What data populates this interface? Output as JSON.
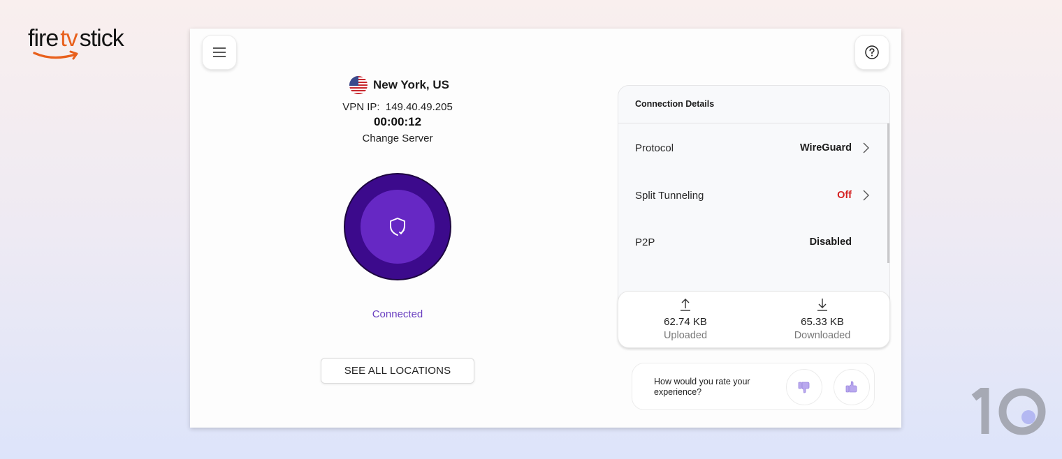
{
  "brand": {
    "logo_parts": [
      "fire",
      "tv",
      "stick"
    ],
    "logo_accent_color": "#e8601c",
    "watermark": "10"
  },
  "header": {
    "menu_icon": "hamburger-menu-icon",
    "help_icon": "help-circle-icon"
  },
  "server": {
    "location": "New York, US",
    "flag": "us-flag-icon",
    "vpn_ip_label": "VPN IP:",
    "vpn_ip": "149.40.49.205",
    "vpn_ip_display": "VPN IP:  149.40.49.205",
    "timer": "00:00:12",
    "change_server_label": "Change Server"
  },
  "connect_button": {
    "icon": "shield-check-icon",
    "outer_color": "#3c0a8c",
    "inner_color": "#6628c4"
  },
  "status": {
    "text": "Connected",
    "color": "#6a3fc0"
  },
  "see_all_locations_label": "SEE ALL LOCATIONS",
  "connection_details": {
    "title": "Connection Details",
    "rows": [
      {
        "label": "Protocol",
        "value": "WireGuard",
        "has_chevron": true
      },
      {
        "label": "Split Tunneling",
        "value": "Off",
        "value_color": "#d42020",
        "has_chevron": true
      },
      {
        "label": "P2P",
        "value": "Disabled",
        "has_chevron": false
      }
    ]
  },
  "traffic": {
    "uploaded": {
      "value": "62.74 KB",
      "label": "Uploaded",
      "icon": "upload-arrow-icon"
    },
    "downloaded": {
      "value": "65.33 KB",
      "label": "Downloaded",
      "icon": "download-arrow-icon"
    }
  },
  "rating": {
    "prompt": "How would you rate your experience?",
    "thumbs_down_icon": "thumbs-down-icon",
    "thumbs_up_icon": "thumbs-up-icon",
    "icon_color": "#b9a8ee"
  }
}
